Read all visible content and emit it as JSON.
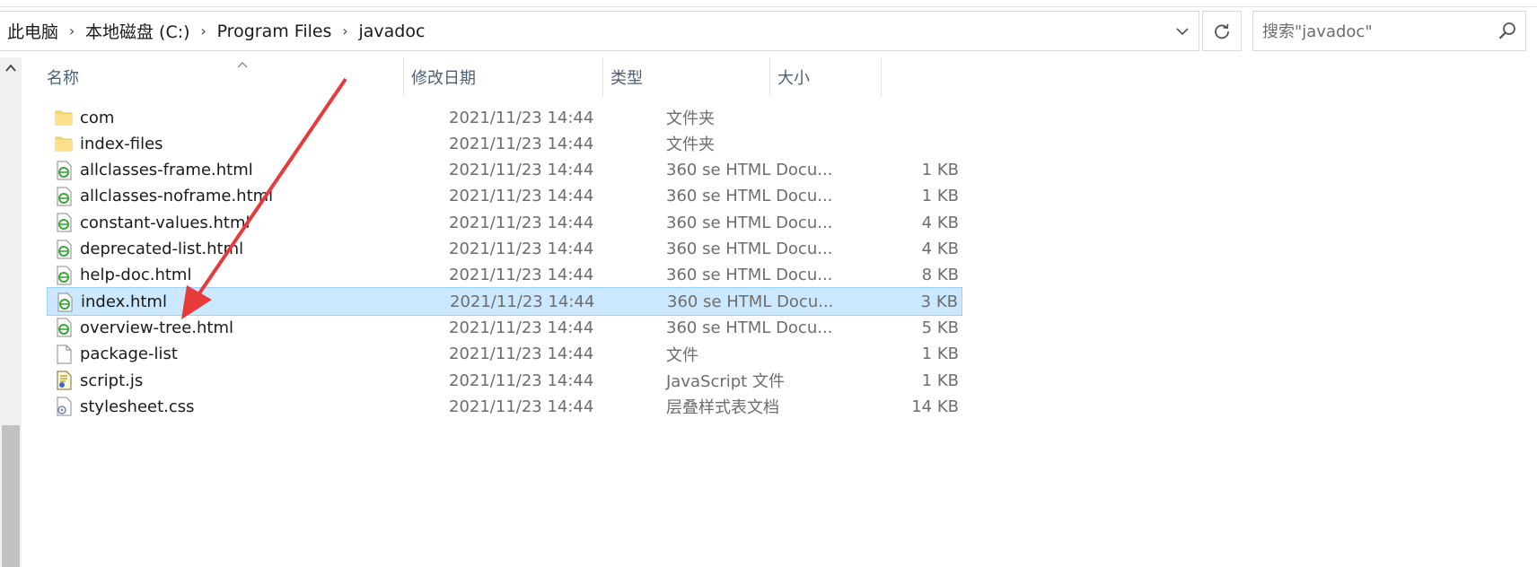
{
  "breadcrumb": {
    "items": [
      "此电脑",
      "本地磁盘 (C:)",
      "Program Files",
      "javadoc"
    ]
  },
  "search": {
    "placeholder": "搜索\"javadoc\""
  },
  "columns": {
    "name": "名称",
    "date": "修改日期",
    "type": "类型",
    "size": "大小"
  },
  "files": [
    {
      "name": "com",
      "date": "2021/11/23 14:44",
      "type": "文件夹",
      "size": "",
      "icon": "folder-icon"
    },
    {
      "name": "index-files",
      "date": "2021/11/23 14:44",
      "type": "文件夹",
      "size": "",
      "icon": "folder-icon"
    },
    {
      "name": "allclasses-frame.html",
      "date": "2021/11/23 14:44",
      "type": "360 se HTML Docu...",
      "size": "1 KB",
      "icon": "html-file-icon"
    },
    {
      "name": "allclasses-noframe.html",
      "date": "2021/11/23 14:44",
      "type": "360 se HTML Docu...",
      "size": "1 KB",
      "icon": "html-file-icon"
    },
    {
      "name": "constant-values.html",
      "date": "2021/11/23 14:44",
      "type": "360 se HTML Docu...",
      "size": "4 KB",
      "icon": "html-file-icon"
    },
    {
      "name": "deprecated-list.html",
      "date": "2021/11/23 14:44",
      "type": "360 se HTML Docu...",
      "size": "4 KB",
      "icon": "html-file-icon"
    },
    {
      "name": "help-doc.html",
      "date": "2021/11/23 14:44",
      "type": "360 se HTML Docu...",
      "size": "8 KB",
      "icon": "html-file-icon"
    },
    {
      "name": "index.html",
      "date": "2021/11/23 14:44",
      "type": "360 se HTML Docu...",
      "size": "3 KB",
      "icon": "html-file-icon",
      "selected": true
    },
    {
      "name": "overview-tree.html",
      "date": "2021/11/23 14:44",
      "type": "360 se HTML Docu...",
      "size": "5 KB",
      "icon": "html-file-icon"
    },
    {
      "name": "package-list",
      "date": "2021/11/23 14:44",
      "type": "文件",
      "size": "1 KB",
      "icon": "blank-file-icon"
    },
    {
      "name": "script.js",
      "date": "2021/11/23 14:44",
      "type": "JavaScript 文件",
      "size": "1 KB",
      "icon": "script-file-icon"
    },
    {
      "name": "stylesheet.css",
      "date": "2021/11/23 14:44",
      "type": "层叠样式表文档",
      "size": "14 KB",
      "icon": "css-file-icon"
    }
  ],
  "colors": {
    "selection": "#cce8ff",
    "selection_border": "#99d1ff",
    "annotation_arrow": "#e8393b",
    "header_text": "#4c607a"
  }
}
